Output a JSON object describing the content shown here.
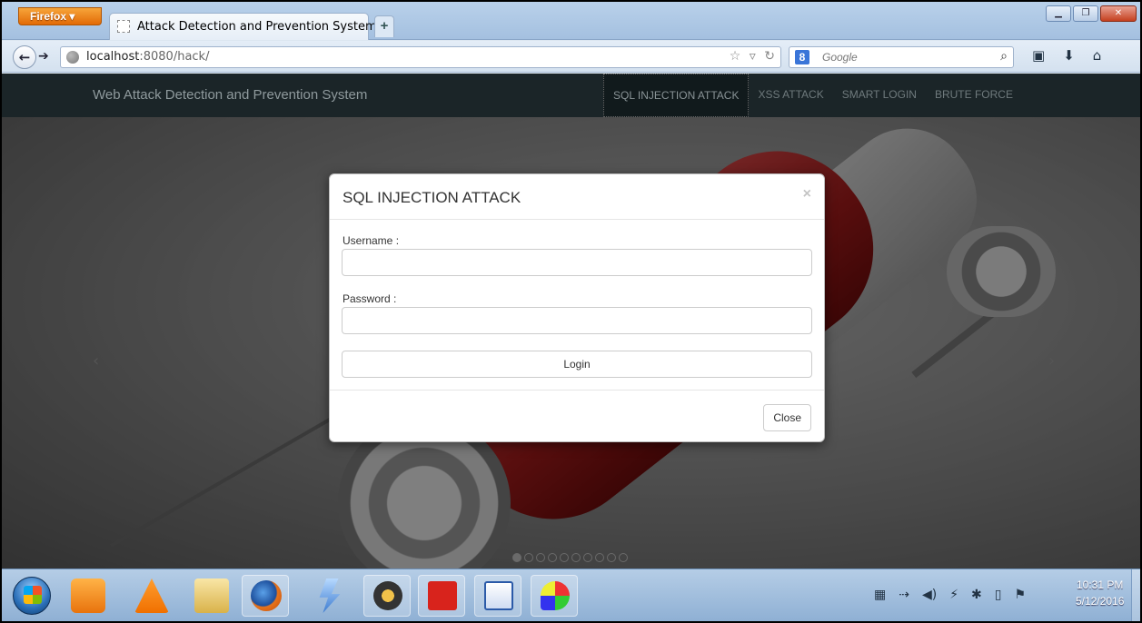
{
  "browser": {
    "app_button": "Firefox ▾",
    "tab_title": "Attack Detection and Prevention System",
    "tab_close": "×",
    "new_tab": "+",
    "url_host": "localhost",
    "url_rest": ":8080/hack/",
    "search_placeholder": "Google",
    "search_engine_letter": "8"
  },
  "site": {
    "brand": "Web Attack Detection and Prevention System",
    "menu": [
      "SQL INJECTION ATTACK",
      "XSS ATTACK",
      "SMART LOGIN",
      "BRUTE FORCE"
    ],
    "active_menu_index": 0
  },
  "modal": {
    "title": "SQL INJECTION ATTACK",
    "close_x": "×",
    "username_label": "Username :",
    "username_value": "",
    "password_label": "Password :",
    "password_value": "",
    "login_label": "Login",
    "close_label": "Close"
  },
  "carousel": {
    "prev": "‹",
    "next": "›",
    "dot_count": 10,
    "active_dot": 0
  },
  "taskbar": {
    "clock_time": "10:31 PM",
    "clock_date": "5/12/2016"
  },
  "colors": {
    "site_nav_bg": "#1b2528",
    "firefox_orange": "#e26a06",
    "taskbar_blue": "#8fb0d4"
  }
}
